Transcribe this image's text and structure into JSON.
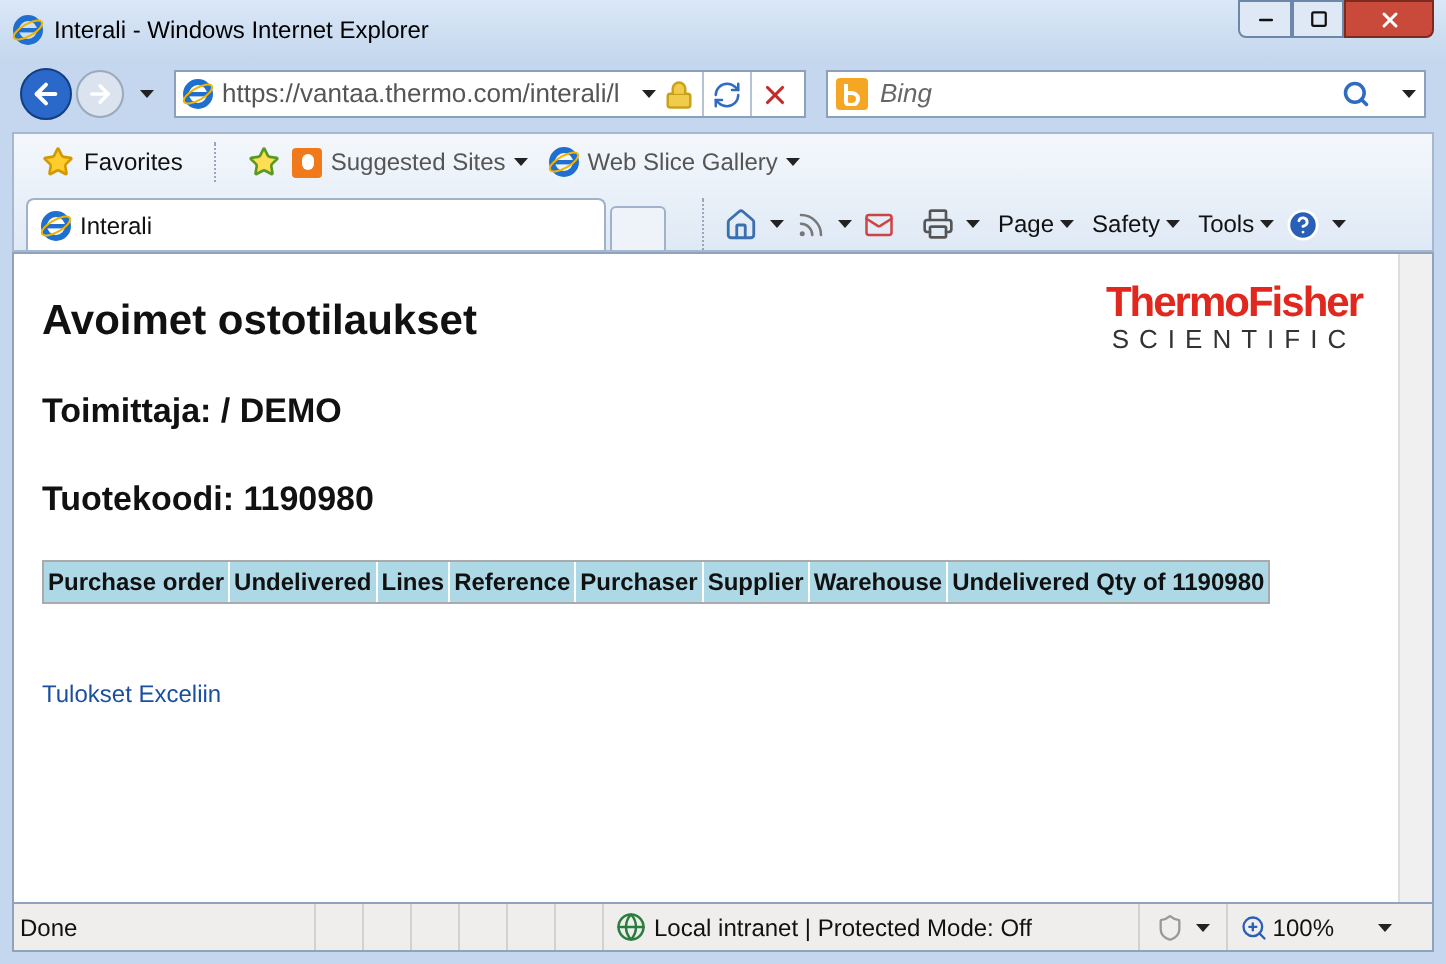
{
  "window": {
    "title": "Interali - Windows Internet Explorer"
  },
  "address_bar": {
    "url": "https://vantaa.thermo.com/interali/l"
  },
  "search": {
    "placeholder": "Bing"
  },
  "favorites_bar": {
    "favorites": "Favorites",
    "links": [
      "Suggested Sites",
      "Web Slice Gallery"
    ]
  },
  "tabs": [
    {
      "label": "Interali",
      "selected": true
    }
  ],
  "command_bar": [
    "Page",
    "Safety",
    "Tools"
  ],
  "page": {
    "logo": {
      "line_1": "ThermoFisher",
      "line_2": "SCIENTIFIC"
    },
    "heading": "Avoimet ostotilaukset",
    "supplier": "Toimittaja: / DEMO",
    "product": "Tuotekoodi: 1190980",
    "table": {
      "columns": [
        "Purchase order",
        "Undelivered",
        "Lines",
        "Reference",
        "Purchaser",
        "Supplier",
        "Warehouse",
        "Undelivered Qty of 1190980"
      ]
    },
    "link": "Tulokset Exceliin"
  },
  "status_bar": {
    "status": "Done",
    "zone": "Local intranet | Protected Mode: Off",
    "zoom": "100%"
  }
}
